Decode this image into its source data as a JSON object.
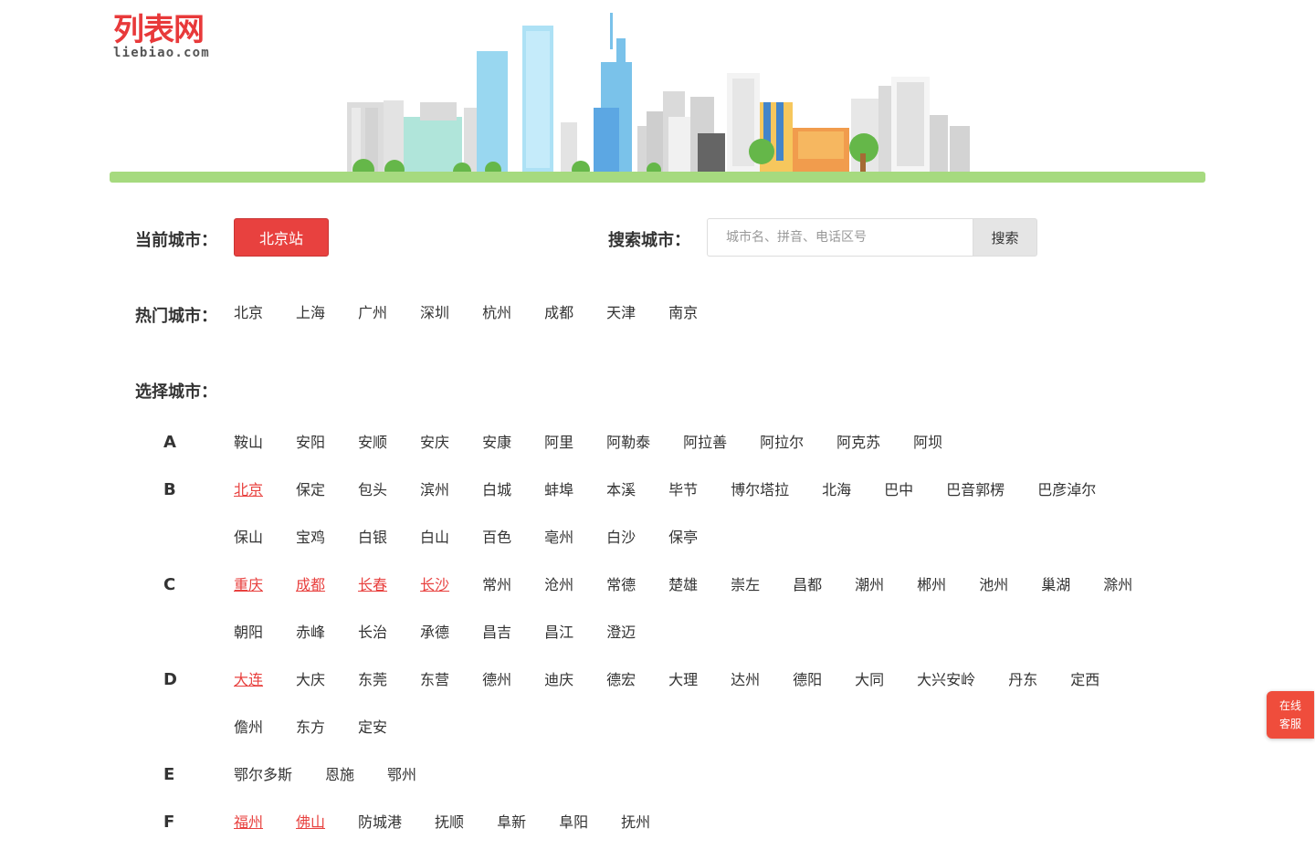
{
  "logo": {
    "main": "列表网",
    "sub": "liebiao.com"
  },
  "current": {
    "label": "当前城市：",
    "city": "北京站"
  },
  "search": {
    "label": "搜索城市：",
    "placeholder": "城市名、拼音、电话区号",
    "button": "搜索"
  },
  "hot": {
    "label": "热门城市：",
    "cities": [
      "北京",
      "上海",
      "广州",
      "深圳",
      "杭州",
      "成都",
      "天津",
      "南京"
    ]
  },
  "select": {
    "label": "选择城市："
  },
  "groups": [
    {
      "letter": "A",
      "cities": [
        {
          "name": "鞍山"
        },
        {
          "name": "安阳"
        },
        {
          "name": "安顺"
        },
        {
          "name": "安庆"
        },
        {
          "name": "安康"
        },
        {
          "name": "阿里"
        },
        {
          "name": "阿勒泰"
        },
        {
          "name": "阿拉善"
        },
        {
          "name": "阿拉尔"
        },
        {
          "name": "阿克苏"
        },
        {
          "name": "阿坝"
        }
      ]
    },
    {
      "letter": "B",
      "cities": [
        {
          "name": "北京",
          "hot": true
        },
        {
          "name": "保定"
        },
        {
          "name": "包头"
        },
        {
          "name": "滨州"
        },
        {
          "name": "白城"
        },
        {
          "name": "蚌埠"
        },
        {
          "name": "本溪"
        },
        {
          "name": "毕节"
        },
        {
          "name": "博尔塔拉"
        },
        {
          "name": "北海"
        },
        {
          "name": "巴中"
        },
        {
          "name": "巴音郭楞"
        },
        {
          "name": "巴彦淖尔"
        },
        {
          "name": "保山"
        },
        {
          "name": "宝鸡"
        },
        {
          "name": "白银"
        },
        {
          "name": "白山"
        },
        {
          "name": "百色"
        },
        {
          "name": "亳州"
        },
        {
          "name": "白沙"
        },
        {
          "name": "保亭"
        }
      ]
    },
    {
      "letter": "C",
      "cities": [
        {
          "name": "重庆",
          "hot": true
        },
        {
          "name": "成都",
          "hot": true
        },
        {
          "name": "长春",
          "hot": true
        },
        {
          "name": "长沙",
          "hot": true
        },
        {
          "name": "常州"
        },
        {
          "name": "沧州"
        },
        {
          "name": "常德"
        },
        {
          "name": "楚雄"
        },
        {
          "name": "崇左"
        },
        {
          "name": "昌都"
        },
        {
          "name": "潮州"
        },
        {
          "name": "郴州"
        },
        {
          "name": "池州"
        },
        {
          "name": "巢湖"
        },
        {
          "name": "滁州"
        },
        {
          "name": "朝阳"
        },
        {
          "name": "赤峰"
        },
        {
          "name": "长治"
        },
        {
          "name": "承德"
        },
        {
          "name": "昌吉"
        },
        {
          "name": "昌江"
        },
        {
          "name": "澄迈"
        }
      ]
    },
    {
      "letter": "D",
      "cities": [
        {
          "name": "大连",
          "hot": true
        },
        {
          "name": "大庆"
        },
        {
          "name": "东莞"
        },
        {
          "name": "东营"
        },
        {
          "name": "德州"
        },
        {
          "name": "迪庆"
        },
        {
          "name": "德宏"
        },
        {
          "name": "大理"
        },
        {
          "name": "达州"
        },
        {
          "name": "德阳"
        },
        {
          "name": "大同"
        },
        {
          "name": "大兴安岭"
        },
        {
          "name": "丹东"
        },
        {
          "name": "定西"
        },
        {
          "name": "儋州"
        },
        {
          "name": "东方"
        },
        {
          "name": "定安"
        }
      ]
    },
    {
      "letter": "E",
      "cities": [
        {
          "name": "鄂尔多斯"
        },
        {
          "name": "恩施"
        },
        {
          "name": "鄂州"
        }
      ]
    },
    {
      "letter": "F",
      "cities": [
        {
          "name": "福州",
          "hot": true
        },
        {
          "name": "佛山",
          "hot": true
        },
        {
          "name": "防城港"
        },
        {
          "name": "抚顺"
        },
        {
          "name": "阜新"
        },
        {
          "name": "阜阳"
        },
        {
          "name": "抚州"
        }
      ]
    }
  ],
  "service": {
    "line1": "在线",
    "line2": "客服"
  },
  "colors": {
    "accent": "#e8413f",
    "ground": "#a6da7f"
  }
}
